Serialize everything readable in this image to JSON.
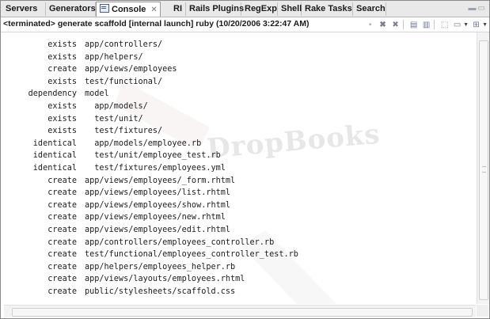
{
  "tabs": [
    {
      "label": "Servers"
    },
    {
      "label": "Generators"
    },
    {
      "label": "Console",
      "active": true
    },
    {
      "label": "RI"
    },
    {
      "label": "Rails Plugins"
    },
    {
      "label": "RegExp"
    },
    {
      "label": "Shell"
    },
    {
      "label": "Rake Tasks"
    },
    {
      "label": "Search"
    }
  ],
  "status": "<terminated> generate scaffold [internal launch] ruby (10/20/2006 3:22:47 AM)",
  "watermark": "DropBooks",
  "colors": {
    "tab_bar": "#e9e9e9",
    "text": "#1c1c1c",
    "border": "#8a8a8a"
  },
  "toolbar_icons": [
    "clear-console-icon",
    "remove-launch-icon",
    "remove-all-terminated-icon",
    "scroll-lock-icon",
    "word-wrap-icon",
    "pin-console-icon",
    "display-selected-console-icon",
    "open-console-icon",
    "minimize-icon",
    "maximize-icon"
  ],
  "output": [
    {
      "action": "exists",
      "path": "app/controllers/"
    },
    {
      "action": "exists",
      "path": "app/helpers/"
    },
    {
      "action": "create",
      "path": "app/views/employees"
    },
    {
      "action": "exists",
      "path": "test/functional/"
    },
    {
      "action": "dependency",
      "path": "model"
    },
    {
      "action": "exists",
      "path": "  app/models/"
    },
    {
      "action": "exists",
      "path": "  test/unit/"
    },
    {
      "action": "exists",
      "path": "  test/fixtures/"
    },
    {
      "action": "identical",
      "path": "  app/models/employee.rb"
    },
    {
      "action": "identical",
      "path": "  test/unit/employee_test.rb"
    },
    {
      "action": "identical",
      "path": "  test/fixtures/employees.yml"
    },
    {
      "action": "create",
      "path": "app/views/employees/_form.rhtml"
    },
    {
      "action": "create",
      "path": "app/views/employees/list.rhtml"
    },
    {
      "action": "create",
      "path": "app/views/employees/show.rhtml"
    },
    {
      "action": "create",
      "path": "app/views/employees/new.rhtml"
    },
    {
      "action": "create",
      "path": "app/views/employees/edit.rhtml"
    },
    {
      "action": "create",
      "path": "app/controllers/employees_controller.rb"
    },
    {
      "action": "create",
      "path": "test/functional/employees_controller_test.rb"
    },
    {
      "action": "create",
      "path": "app/helpers/employees_helper.rb"
    },
    {
      "action": "create",
      "path": "app/views/layouts/employees.rhtml"
    },
    {
      "action": "create",
      "path": "public/stylesheets/scaffold.css"
    }
  ]
}
